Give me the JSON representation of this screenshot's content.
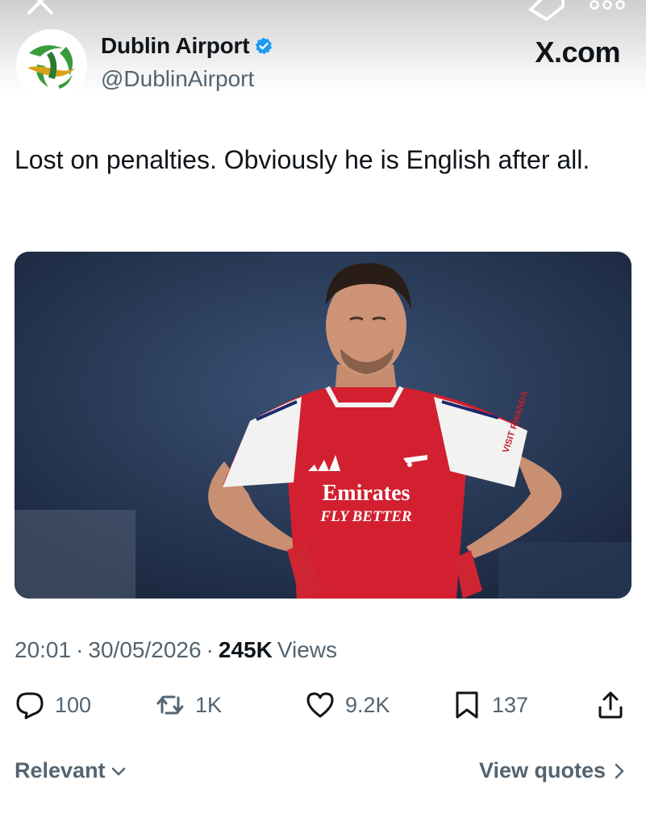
{
  "header": {
    "display_name": "Dublin Airport",
    "handle": "@DublinAirport",
    "site_label": "X.com",
    "verified": true
  },
  "tweet": {
    "text": "Lost on penalties. Obviously he is English after all.",
    "image": {
      "shirt_sponsor_line1": "Emirates",
      "shirt_sponsor_line2": "FLY BETTER",
      "sleeve_text": "VISIT RWANDA"
    }
  },
  "meta": {
    "time": "20:01",
    "separator": "·",
    "date": "30/05/2026",
    "views_count": "245K",
    "views_label": "Views"
  },
  "actions": {
    "replies": "100",
    "reposts": "1K",
    "likes": "9.2K",
    "bookmarks": "137"
  },
  "footer": {
    "sort_label": "Relevant",
    "view_quotes_label": "View quotes"
  },
  "colors": {
    "text_primary": "#0f1419",
    "text_secondary": "#536471",
    "verified_blue": "#1d9bf0",
    "logo_green": "#3a9a3c",
    "logo_gold": "#d9a21b",
    "shirt_red": "#d22030"
  },
  "icons": [
    "close-icon",
    "tag-icon",
    "more-icon",
    "verified-badge-icon",
    "reply-icon",
    "repost-icon",
    "like-icon",
    "bookmark-icon",
    "share-icon",
    "chevron-down-icon",
    "chevron-right-icon"
  ]
}
